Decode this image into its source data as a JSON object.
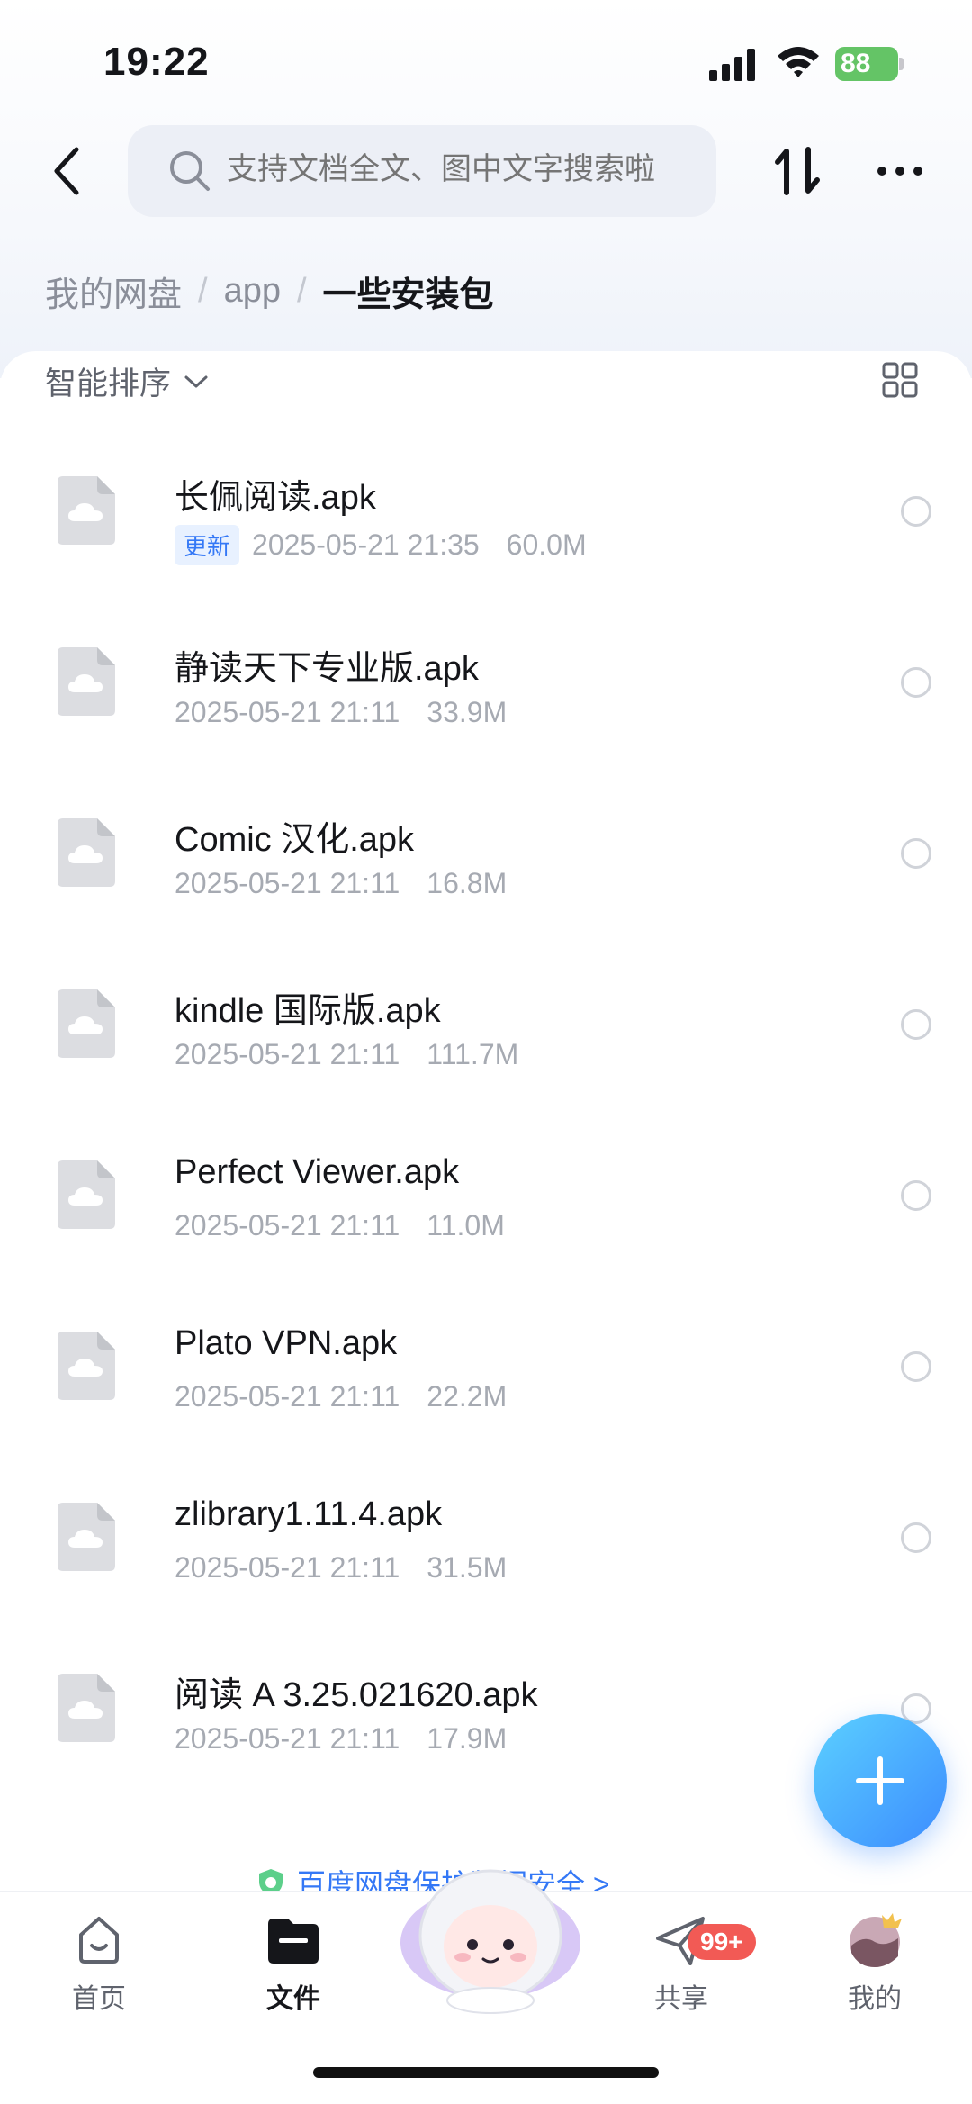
{
  "status_bar": {
    "time": "19:22",
    "battery": "88"
  },
  "search": {
    "placeholder": "支持文档全文、图中文字搜索啦"
  },
  "breadcrumb": {
    "items": [
      "我的网盘",
      "app",
      "一些安装包"
    ]
  },
  "toolbar": {
    "sort_label": "智能排序"
  },
  "files": [
    {
      "name": "长佩阅读.apk",
      "tag": "更新",
      "date": "2025-05-21 21:35",
      "size": "60.0M"
    },
    {
      "name": "静读天下专业版.apk",
      "date": "2025-05-21 21:11",
      "size": "33.9M"
    },
    {
      "name": "Comic 汉化.apk",
      "date": "2025-05-21 21:11",
      "size": "16.8M"
    },
    {
      "name": "kindle 国际版.apk",
      "date": "2025-05-21 21:11",
      "size": "111.7M"
    },
    {
      "name": "Perfect Viewer.apk",
      "date": "2025-05-21 21:11",
      "size": "11.0M"
    },
    {
      "name": "Plato VPN.apk",
      "date": "2025-05-21 21:11",
      "size": "22.2M"
    },
    {
      "name": "zlibrary1.11.4.apk",
      "date": "2025-05-21 21:11",
      "size": "31.5M"
    },
    {
      "name": "阅读 A 3.25.021620.apk",
      "date": "2025-05-21 21:11",
      "size": "17.9M"
    }
  ],
  "banner": {
    "text": "百度网盘保护数据安全 >"
  },
  "tabbar": {
    "items": [
      {
        "label": "首页"
      },
      {
        "label": "文件"
      },
      {
        "label": "共享",
        "badge": "99+"
      },
      {
        "label": "我的"
      }
    ]
  },
  "colors": {
    "accent": "#3478f6",
    "badge": "#f25a55",
    "battery": "#64c466"
  }
}
